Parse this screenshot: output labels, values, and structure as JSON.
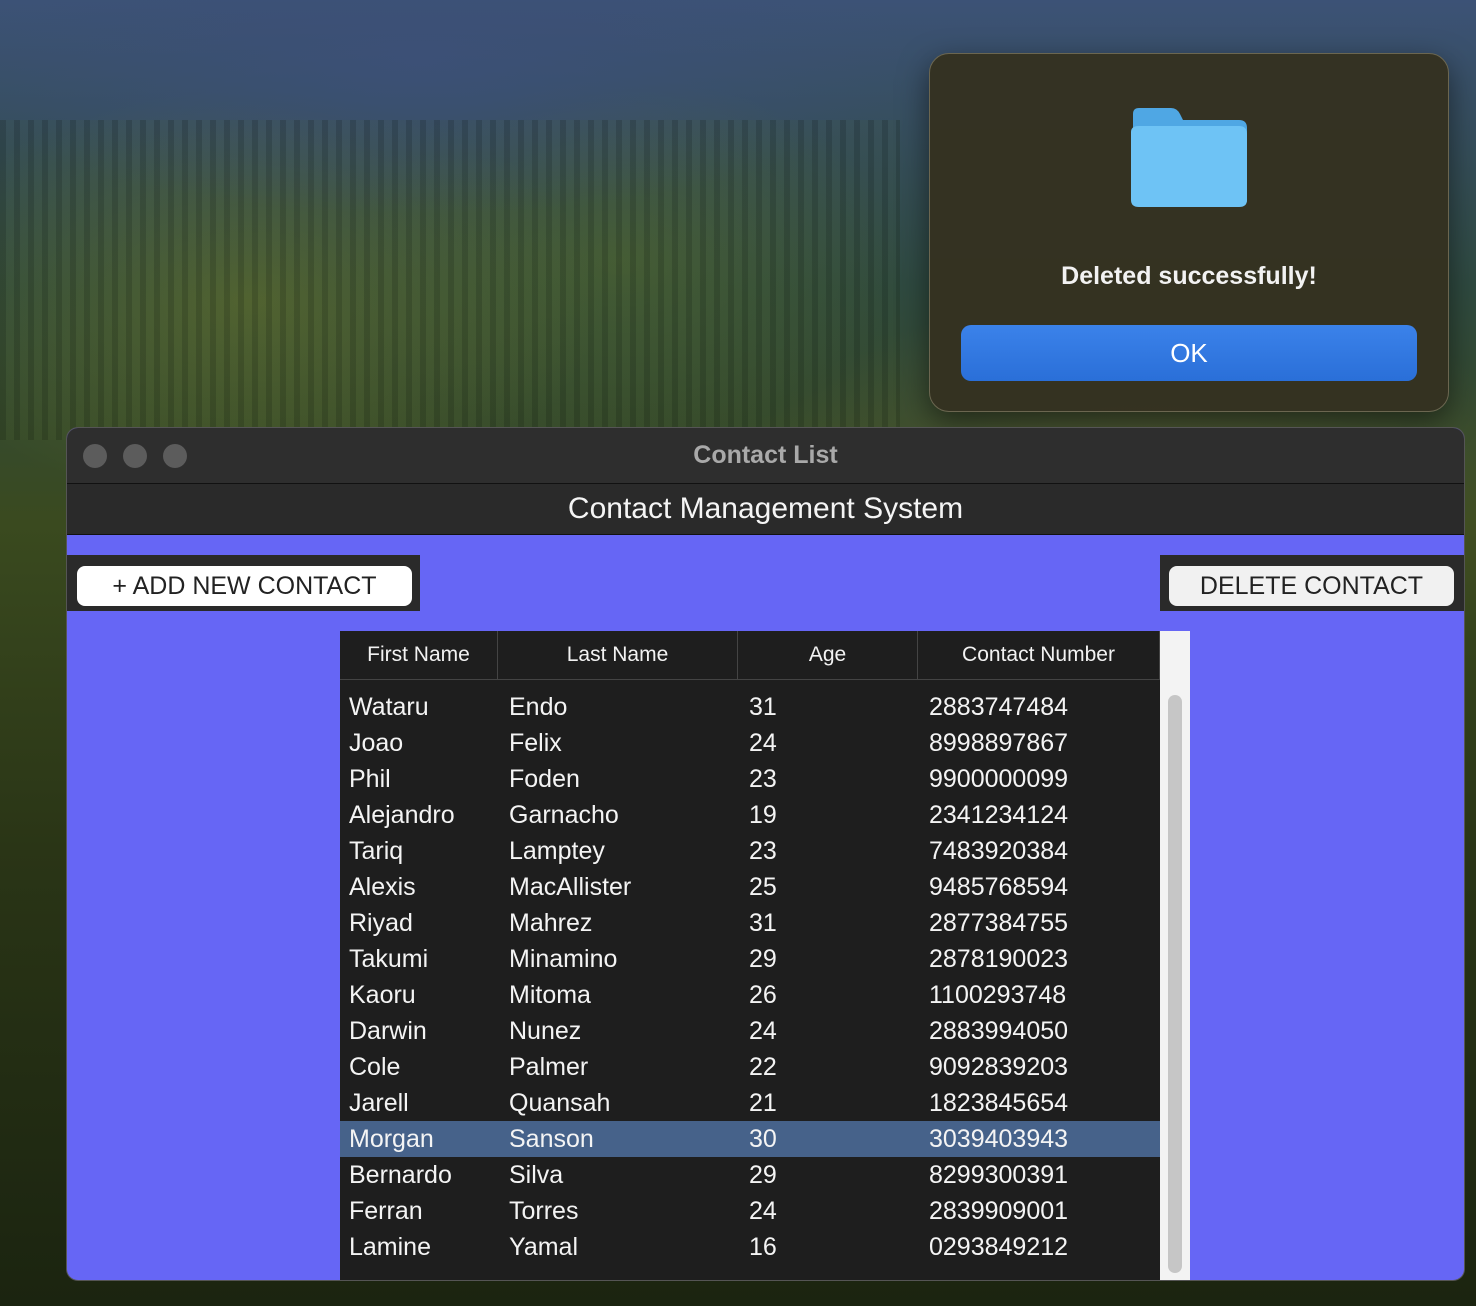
{
  "alert": {
    "message": "Deleted successfully!",
    "ok_label": "OK",
    "icon": "folder-icon"
  },
  "window": {
    "title": "Contact List",
    "header": "Contact Management System",
    "add_button_label": "+ ADD NEW CONTACT",
    "delete_button_label": "DELETE CONTACT"
  },
  "table": {
    "columns": [
      "First Name",
      "Last Name",
      "Age",
      "Contact Number"
    ],
    "selected_index": 12,
    "rows": [
      [
        "Wataru",
        "Endo",
        "31",
        "2883747484"
      ],
      [
        "Joao",
        "Felix",
        "24",
        "8998897867"
      ],
      [
        "Phil",
        "Foden",
        "23",
        "9900000099"
      ],
      [
        "Alejandro",
        "Garnacho",
        "19",
        "2341234124"
      ],
      [
        "Tariq",
        "Lamptey",
        "23",
        "7483920384"
      ],
      [
        "Alexis",
        "MacAllister",
        "25",
        "9485768594"
      ],
      [
        "Riyad",
        "Mahrez",
        "31",
        "2877384755"
      ],
      [
        "Takumi",
        "Minamino",
        "29",
        "2878190023"
      ],
      [
        "Kaoru",
        "Mitoma",
        "26",
        "1100293748"
      ],
      [
        "Darwin",
        "Nunez",
        "24",
        "2883994050"
      ],
      [
        "Cole",
        "Palmer",
        "22",
        "9092839203"
      ],
      [
        "Jarell",
        "Quansah",
        "21",
        "1823845654"
      ],
      [
        "Morgan",
        "Sanson",
        "30",
        "3039403943"
      ],
      [
        "Bernardo",
        "Silva",
        "29",
        "8299300391"
      ],
      [
        "Ferran",
        "Torres",
        "24",
        "2839909001"
      ],
      [
        "Lamine",
        "Yamal",
        "16",
        "0293849212"
      ]
    ]
  },
  "colors": {
    "window_bg": "#6666f5",
    "selected_row": "#46628a",
    "ok_button": "#2f74de"
  }
}
